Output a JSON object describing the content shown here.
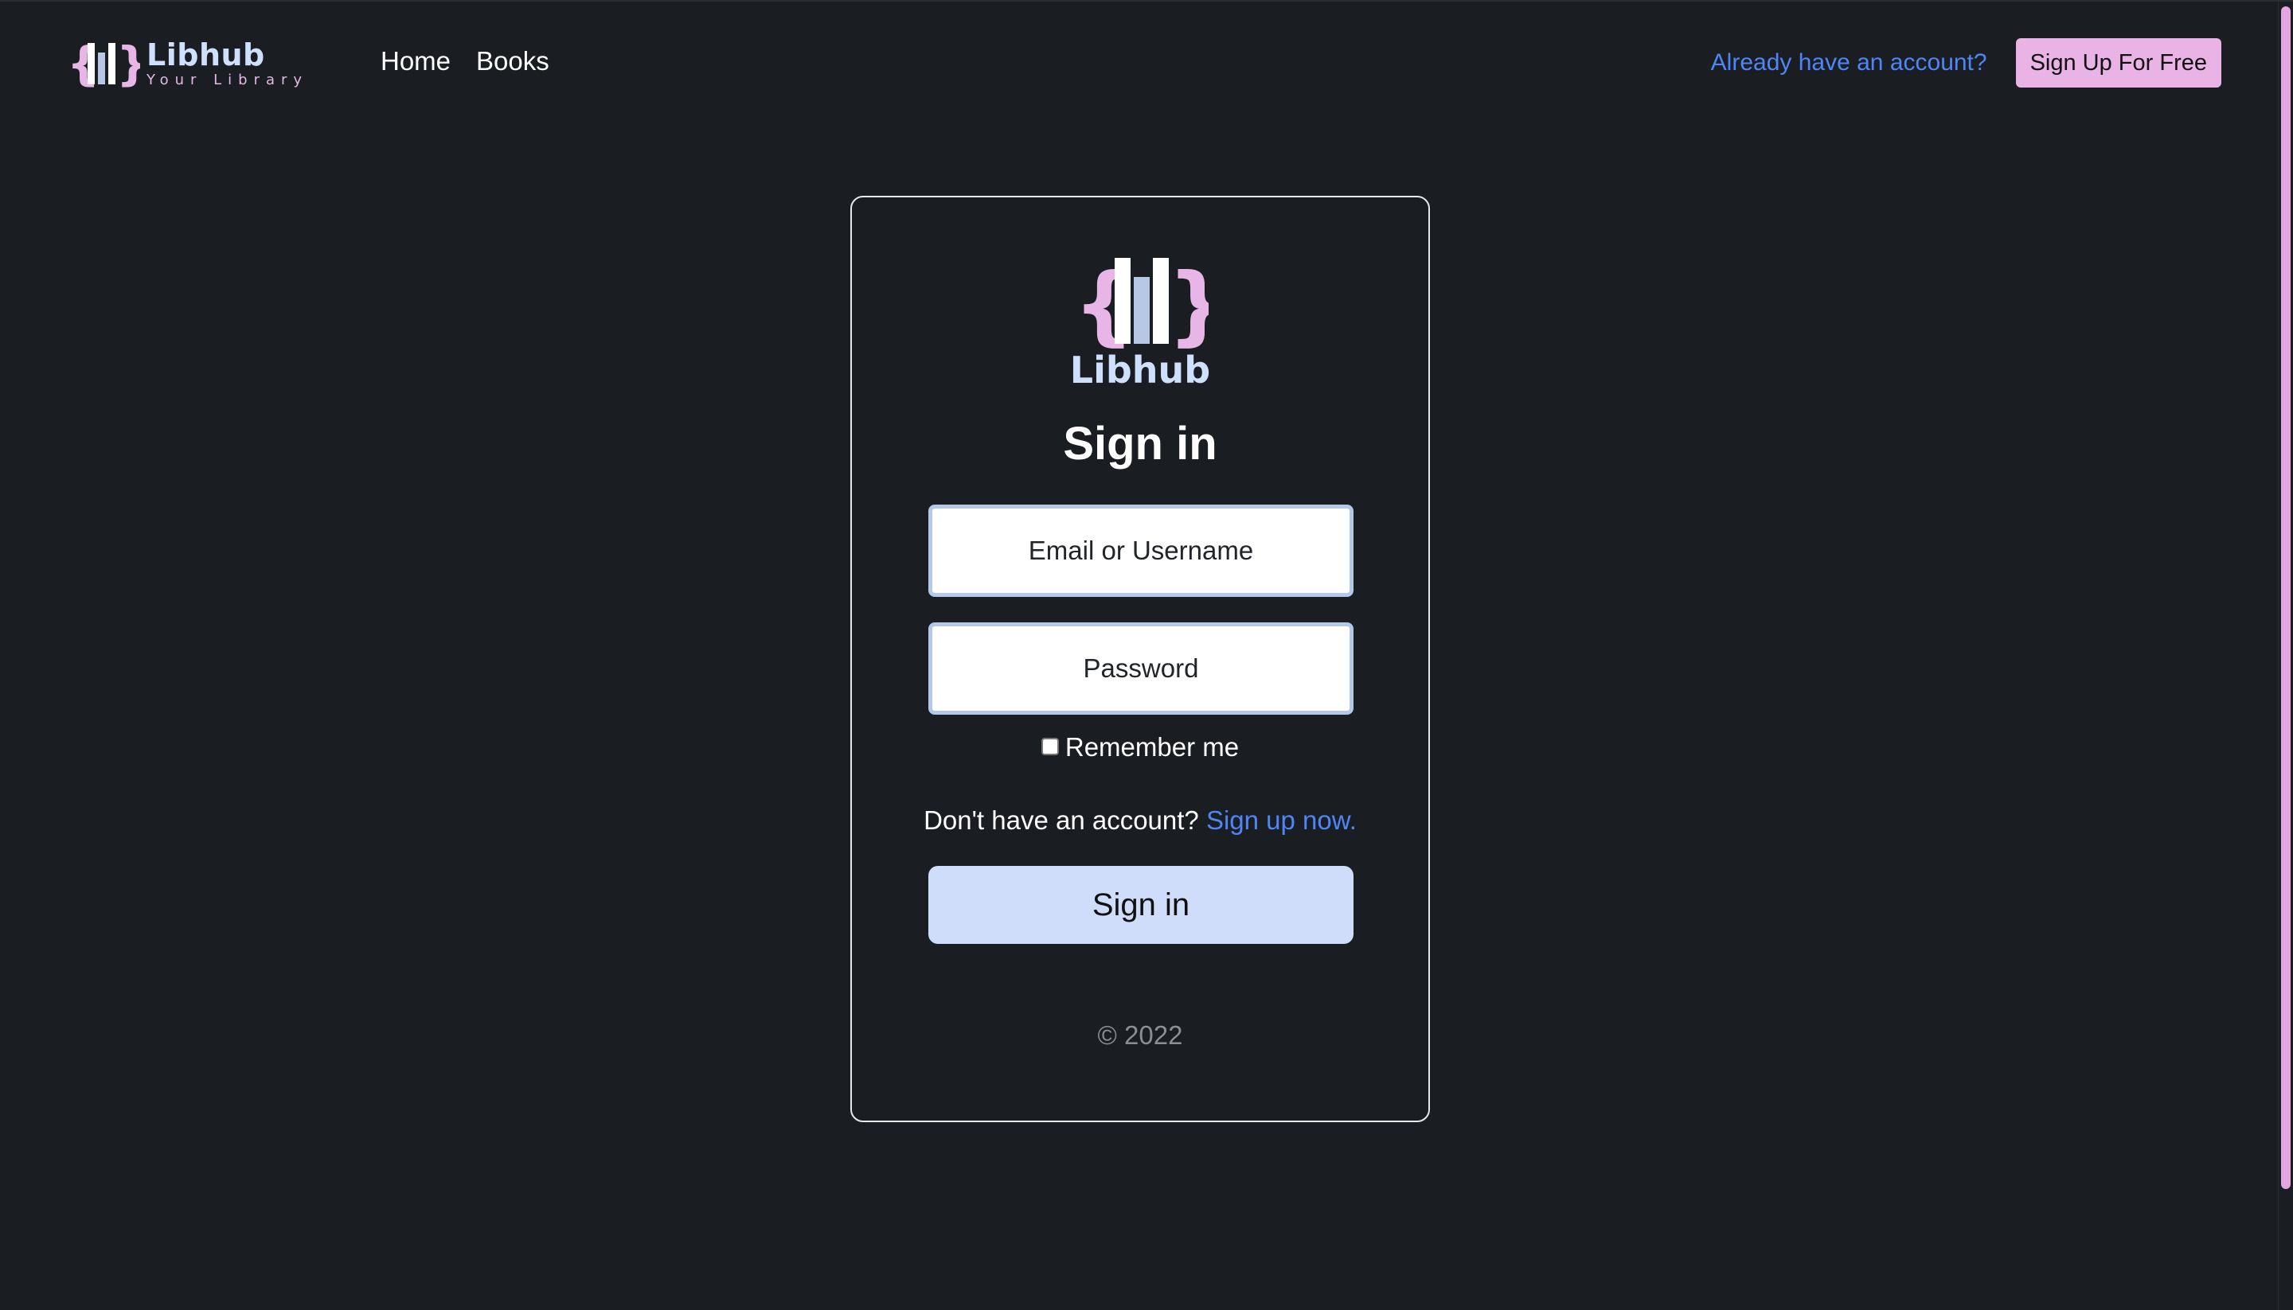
{
  "navbar": {
    "brand_name": "Libhub",
    "brand_tagline": "Your Library",
    "links": [
      {
        "label": "Home"
      },
      {
        "label": "Books"
      }
    ],
    "login_link": "Already have an account?",
    "signup_button": "Sign Up For Free"
  },
  "login": {
    "brand_name": "Libhub",
    "title": "Sign in",
    "email_placeholder": "Email or Username",
    "password_placeholder": "Password",
    "remember_label": "Remember me",
    "remember_checked": false,
    "no_account_text": "Don't have an account?",
    "signup_link": "Sign up now.",
    "submit_label": "Sign in",
    "copyright": "© 2022"
  },
  "icons": {
    "logo": "libhub-books-braces-logo",
    "checkbox": "checkbox-unchecked"
  },
  "colors": {
    "background": "#1a1d21",
    "brand_text": "#cfe0ff",
    "brace_pink": "#e7b6e6",
    "link_blue": "#4f86f7",
    "signup_button_bg": "#e9b3e6",
    "submit_button_bg": "#cfdcfa",
    "input_border": "#b4c8ea",
    "scrollbar_thumb": "#e4a6e0"
  }
}
